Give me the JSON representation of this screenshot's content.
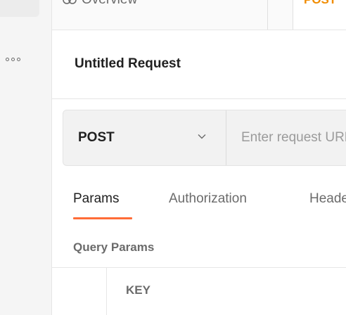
{
  "tabs": {
    "overview_label": "Overview",
    "active_method": "POST"
  },
  "request": {
    "title": "Untitled Request",
    "method": "POST",
    "url_placeholder": "Enter request URL",
    "url_value": ""
  },
  "subtabs": [
    {
      "label": "Params",
      "active": true
    },
    {
      "label": "Authorization",
      "active": false
    },
    {
      "label": "Headers",
      "active": false
    }
  ],
  "params": {
    "section_title": "Query Params",
    "columns": [
      "KEY"
    ]
  },
  "colors": {
    "accent": "#ff6c37",
    "post_method": "#f08c00"
  }
}
